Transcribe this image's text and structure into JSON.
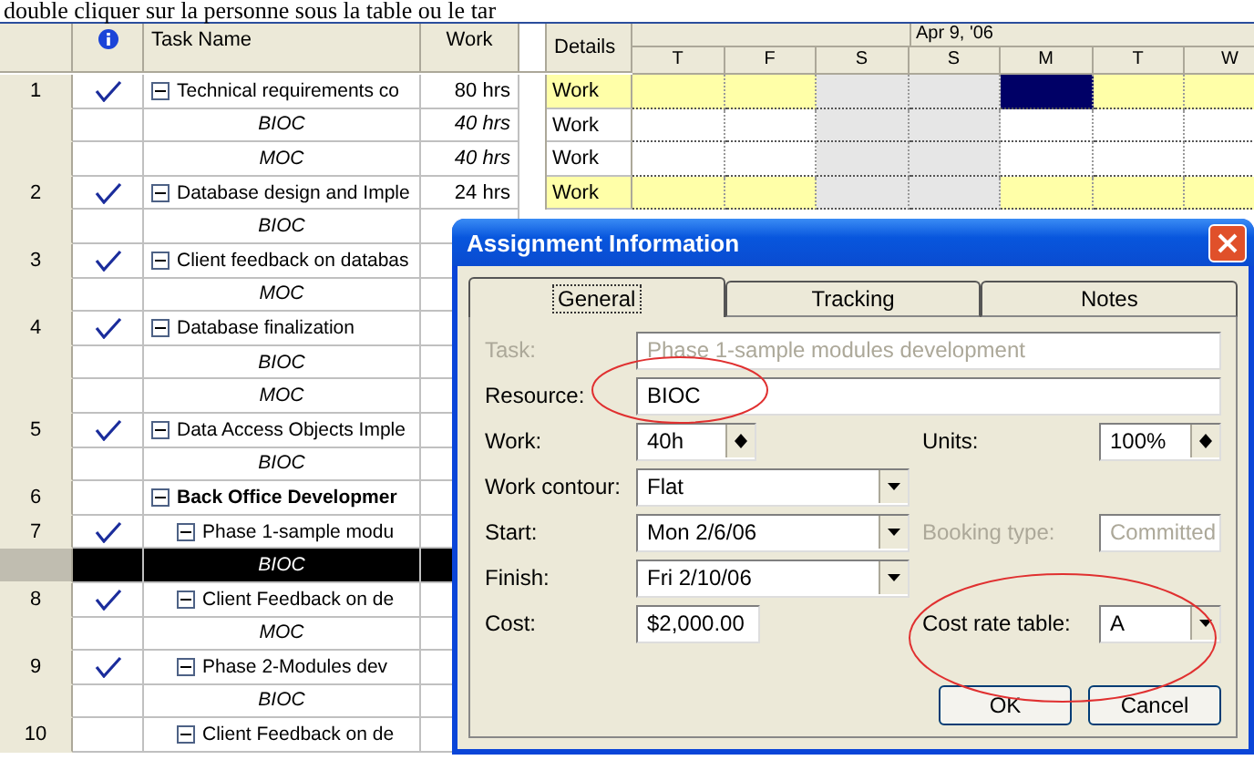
{
  "caption": "double cliquer sur la personne sous la table ou le tar",
  "table": {
    "columns": [
      {
        "kind": "indicator"
      },
      {
        "kind": "name",
        "label": "Task Name"
      },
      {
        "kind": "work",
        "label": "Work"
      }
    ],
    "details_header": "Details",
    "timescale": {
      "week": "Apr 9, '06",
      "days": [
        {
          "label": "T",
          "weekend": false
        },
        {
          "label": "F",
          "weekend": false
        },
        {
          "label": "S",
          "weekend": true
        },
        {
          "label": "S",
          "weekend": true
        },
        {
          "label": "M",
          "weekend": false
        },
        {
          "label": "T",
          "weekend": false
        },
        {
          "label": "W",
          "weekend": false
        }
      ]
    },
    "rows": [
      {
        "id": "1",
        "kind": "task",
        "done": true,
        "selected": false,
        "name": "Technical requirements co",
        "work": "80 hrs",
        "details": "Work",
        "timeline": [
          {
            "selected": false
          },
          {
            "selected": false
          },
          {
            "selected": false
          },
          {
            "selected": false
          },
          {
            "selected": true
          },
          {
            "selected": false
          },
          {
            "selected": false
          }
        ],
        "children": [
          {
            "kind": "assignment",
            "done": false,
            "selected": false,
            "name": "BIOC",
            "work": "40 hrs",
            "details": "Work",
            "timeline": [
              {
                "selected": false
              },
              {
                "selected": false
              },
              {
                "selected": false
              },
              {
                "selected": false
              },
              {
                "selected": false
              },
              {
                "selected": false
              },
              {
                "selected": false
              }
            ]
          },
          {
            "kind": "assignment",
            "done": false,
            "selected": false,
            "name": "MOC",
            "work": "40 hrs",
            "details": "Work",
            "timeline": [
              {
                "selected": false
              },
              {
                "selected": false
              },
              {
                "selected": false
              },
              {
                "selected": false
              },
              {
                "selected": false
              },
              {
                "selected": false
              },
              {
                "selected": false
              }
            ]
          }
        ]
      },
      {
        "id": "2",
        "kind": "task",
        "done": true,
        "selected": false,
        "name": "Database design and Imple",
        "work": "24 hrs",
        "details": "Work",
        "timeline": [
          {
            "selected": false
          },
          {
            "selected": false
          },
          {
            "selected": false
          },
          {
            "selected": false
          },
          {
            "selected": false
          },
          {
            "selected": false
          },
          {
            "selected": false
          }
        ],
        "children": [
          {
            "kind": "assignment",
            "done": false,
            "selected": false,
            "name": "BIOC"
          }
        ]
      },
      {
        "id": "3",
        "kind": "task",
        "done": true,
        "selected": false,
        "name": "Client feedback on databas",
        "children": [
          {
            "kind": "assignment",
            "done": false,
            "selected": false,
            "name": "MOC"
          }
        ]
      },
      {
        "id": "4",
        "kind": "task",
        "done": true,
        "selected": false,
        "name": "Database finalization",
        "children": [
          {
            "kind": "assignment",
            "done": false,
            "selected": false,
            "name": "BIOC"
          },
          {
            "kind": "assignment",
            "done": false,
            "selected": false,
            "name": "MOC"
          }
        ]
      },
      {
        "id": "5",
        "kind": "task",
        "done": true,
        "selected": false,
        "name": "Data Access Objects Imple",
        "children": [
          {
            "kind": "assignment",
            "done": false,
            "selected": false,
            "name": "BIOC"
          }
        ]
      },
      {
        "id": "6",
        "kind": "summary",
        "done": false,
        "selected": false,
        "name": "Back Office Developmer",
        "children": [
          {
            "id": "7",
            "kind": "task",
            "done": true,
            "selected": false,
            "name": "Phase 1-sample modu",
            "children": [
              {
                "kind": "assignment",
                "done": false,
                "selected": true,
                "name": "BIOC"
              }
            ]
          },
          {
            "id": "8",
            "kind": "task",
            "done": true,
            "selected": false,
            "name": "Client Feedback on de",
            "children": [
              {
                "kind": "assignment",
                "done": false,
                "selected": false,
                "name": "MOC"
              }
            ]
          },
          {
            "id": "9",
            "kind": "task",
            "done": true,
            "selected": false,
            "name": "Phase 2-Modules dev",
            "children": [
              {
                "kind": "assignment",
                "done": false,
                "selected": false,
                "name": "BIOC"
              }
            ]
          },
          {
            "id": "10",
            "kind": "task",
            "done": false,
            "selected": false,
            "name": "Client Feedback on de"
          }
        ]
      }
    ]
  },
  "dialog": {
    "title": "Assignment Information",
    "tabs": [
      {
        "label": "General",
        "selected": true
      },
      {
        "label": "Tracking",
        "selected": false
      },
      {
        "label": "Notes",
        "selected": false
      }
    ],
    "rows": [
      [
        {
          "label": "Task:",
          "kind": "text",
          "value": "Phase 1-sample modules development",
          "disabled": true,
          "wide": true
        }
      ],
      [
        {
          "label": "Resource:",
          "kind": "text",
          "value": "BIOC",
          "disabled": false,
          "wide": true
        }
      ],
      [
        {
          "label": "Work:",
          "kind": "spin",
          "value": "40h",
          "disabled": false,
          "wide": false
        },
        {
          "label": "Units:",
          "kind": "spin",
          "value": "100%",
          "disabled": false,
          "wide": false
        }
      ],
      [
        {
          "label": "Work contour:",
          "kind": "dropdown",
          "value": "Flat",
          "disabled": false,
          "wide": false
        }
      ],
      [
        {
          "label": "Start:",
          "kind": "dropdown",
          "value": "Mon 2/6/06",
          "disabled": false,
          "wide": false
        },
        {
          "label": "Booking type:",
          "kind": "text",
          "value": "Committed",
          "disabled": true,
          "wide": false
        }
      ],
      [
        {
          "label": "Finish:",
          "kind": "dropdown",
          "value": "Fri 2/10/06",
          "disabled": false,
          "wide": false
        }
      ],
      [
        {
          "label": "Cost:",
          "kind": "text",
          "value": "$2,000.00",
          "disabled": false,
          "wide": false
        },
        {
          "label": "Cost rate table:",
          "kind": "dropdown",
          "value": "A",
          "disabled": false,
          "wide": false
        }
      ]
    ],
    "buttons": [
      "OK",
      "Cancel"
    ]
  }
}
